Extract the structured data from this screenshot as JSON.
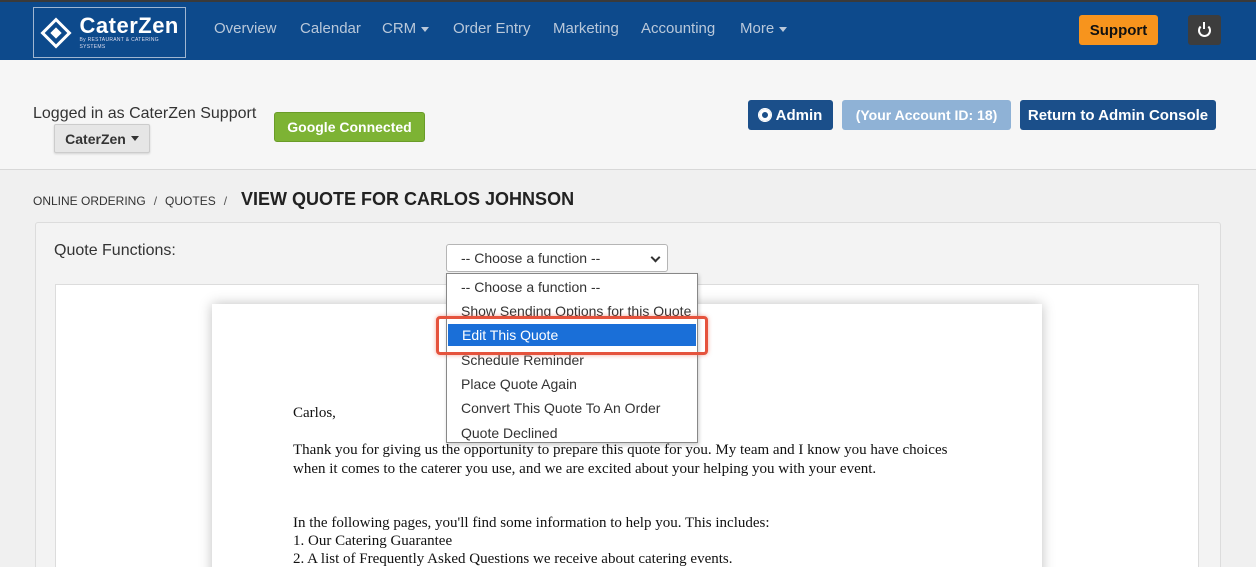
{
  "brand": {
    "name": "CaterZen",
    "tagline": "By RESTAURANT & CATERING SYSTEMS"
  },
  "nav": {
    "items": [
      "Overview",
      "Calendar",
      "CRM",
      "Order Entry",
      "Marketing",
      "Accounting",
      "More"
    ],
    "support_label": "Support"
  },
  "account": {
    "logged_in": "Logged in as CaterZen Support",
    "org_dropdown": "CaterZen",
    "google": "Google Connected",
    "admin": "Admin",
    "account_id": "(Your Account ID: 18)",
    "return": "Return to Admin Console"
  },
  "breadcrumb": {
    "items": [
      "Online Ordering",
      "Quotes"
    ],
    "title": "View Quote for Carlos Johnson"
  },
  "quote_functions": {
    "label": "Quote Functions:",
    "selected": "-- Choose a function --",
    "options": [
      "-- Choose a function --",
      "Show Sending Options for this Quote",
      "Edit This Quote",
      "Schedule Reminder",
      "Place Quote Again",
      "Convert This Quote To An Order",
      "Quote Declined"
    ],
    "highlighted_index": 2
  },
  "document": {
    "greeting": "Carlos,",
    "para1": "Thank you for giving us the opportunity to prepare this quote for you. My team and I know you have choices when it comes to the caterer you use, and we are excited about your helping you with your event.",
    "para2_intro": "In the following pages, you'll find some information to help you. This includes:",
    "list": [
      "1. Our Catering Guarantee",
      "2. A list of Frequently Asked Questions we receive about catering events."
    ]
  },
  "colors": {
    "nav_bg": "#0d4a8c",
    "support": "#f7941d",
    "google": "#7db334",
    "admin": "#1b4f8a",
    "selected_option": "#1a6fd8",
    "highlight": "#e5533d"
  }
}
